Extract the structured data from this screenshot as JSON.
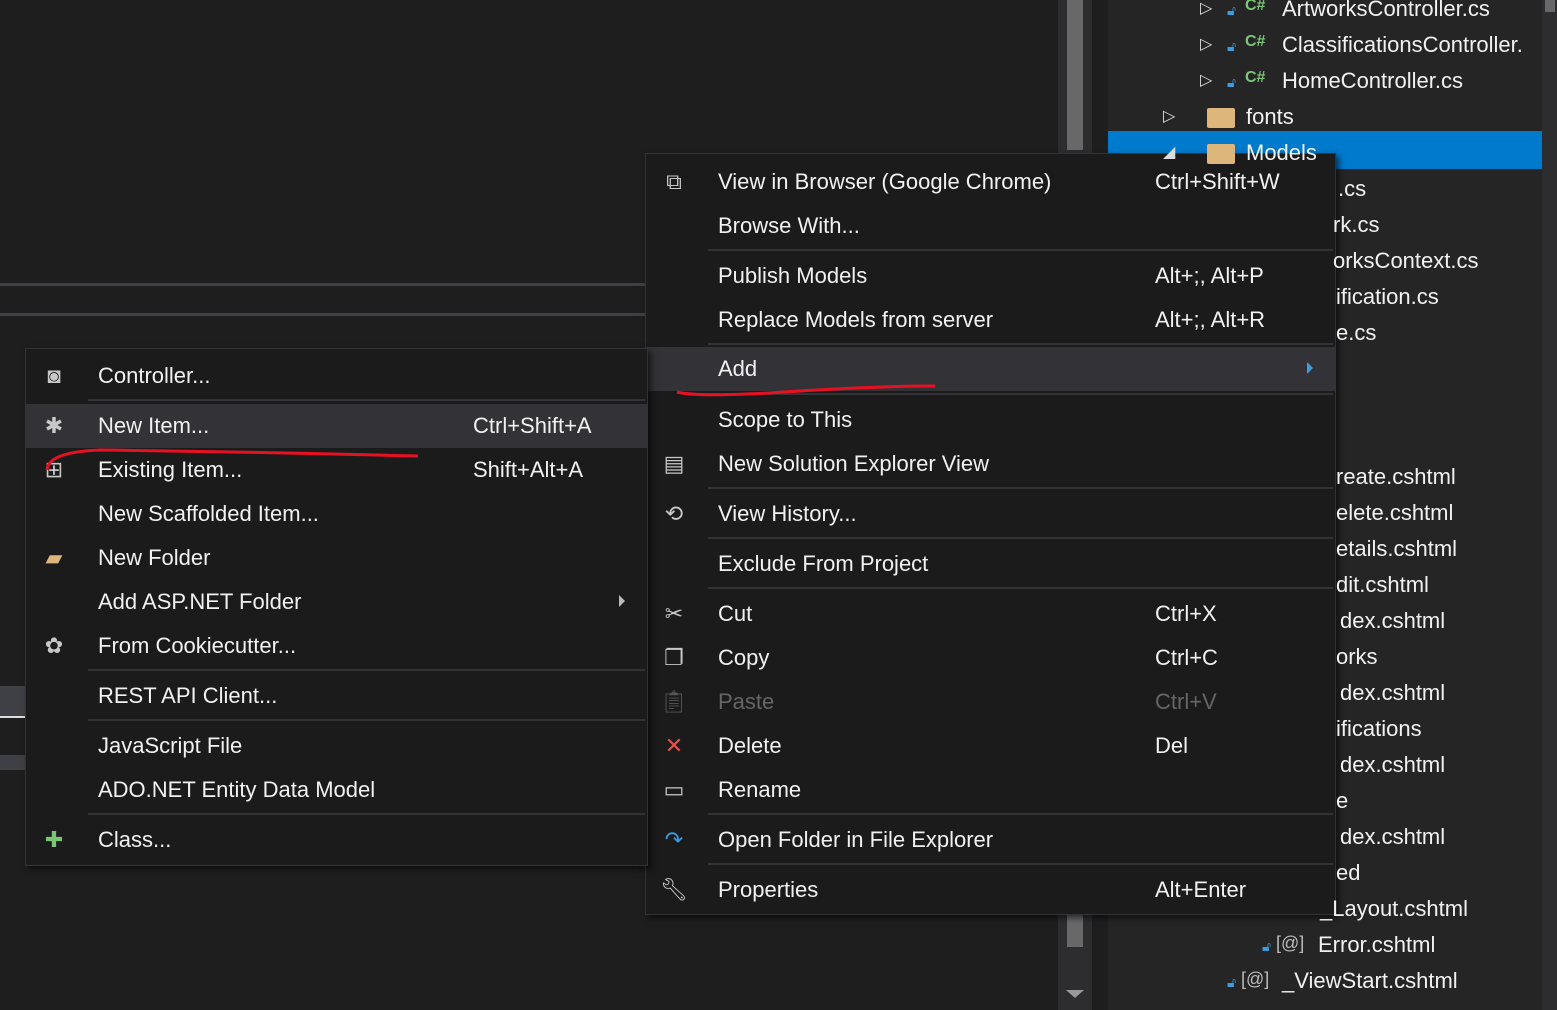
{
  "solution_explorer": {
    "rows_top": [
      {
        "label": "ArtworksController.cs",
        "kind": "csharp"
      },
      {
        "label": "ClassificationsController.",
        "kind": "csharp"
      },
      {
        "label": "HomeController.cs",
        "kind": "csharp"
      },
      {
        "label": "fonts",
        "kind": "folder"
      },
      {
        "label": "Models",
        "kind": "folder-open",
        "selected": true
      }
    ],
    "partial_rows": [
      ".cs",
      "rk.cs",
      "orksContext.cs",
      "ification.cs",
      "e.cs",
      "reate.cshtml",
      "elete.cshtml",
      "etails.cshtml",
      "dit.cshtml",
      "dex.cshtml",
      "orks",
      "dex.cshtml",
      "ifications",
      "dex.cshtml",
      "e",
      "dex.cshtml",
      "ed",
      "_Layout.cshtml"
    ],
    "rows_bottom": [
      {
        "label": "Error.cshtml"
      },
      {
        "label": "_ViewStart.cshtml"
      }
    ],
    "csharp_glyph": "C#",
    "razor_glyph": "[@]"
  },
  "context_menu": {
    "items": [
      {
        "label": "View in Browser (Google Chrome)",
        "shortcut": "Ctrl+Shift+W",
        "icon": "browser-icon"
      },
      {
        "label": "Browse With...",
        "shortcut": ""
      },
      {
        "label": "Publish Models",
        "shortcut": "Alt+;, Alt+P"
      },
      {
        "label": "Replace Models from server",
        "shortcut": "Alt+;, Alt+R"
      },
      {
        "label": "Add",
        "shortcut": "",
        "submenu": true,
        "highlighted": true
      },
      {
        "label": "Scope to This",
        "shortcut": ""
      },
      {
        "label": "New Solution Explorer View",
        "shortcut": "",
        "icon": "solution-explorer-icon"
      },
      {
        "label": "View History...",
        "shortcut": "",
        "icon": "history-icon"
      },
      {
        "label": "Exclude From Project",
        "shortcut": ""
      },
      {
        "label": "Cut",
        "shortcut": "Ctrl+X",
        "icon": "scissors-icon"
      },
      {
        "label": "Copy",
        "shortcut": "Ctrl+C",
        "icon": "copy-icon"
      },
      {
        "label": "Paste",
        "shortcut": "Ctrl+V",
        "icon": "paste-icon",
        "disabled": true
      },
      {
        "label": "Delete",
        "shortcut": "Del",
        "icon": "delete-icon"
      },
      {
        "label": "Rename",
        "shortcut": "",
        "icon": "rename-icon"
      },
      {
        "label": "Open Folder in File Explorer",
        "shortcut": "",
        "icon": "open-folder-icon"
      },
      {
        "label": "Properties",
        "shortcut": "Alt+Enter",
        "icon": "wrench-icon"
      }
    ]
  },
  "add_submenu": {
    "items": [
      {
        "label": "Controller...",
        "shortcut": "",
        "icon": "controller-icon"
      },
      {
        "label": "New Item...",
        "shortcut": "Ctrl+Shift+A",
        "icon": "new-item-icon",
        "highlighted": true
      },
      {
        "label": "Existing Item...",
        "shortcut": "Shift+Alt+A",
        "icon": "existing-item-icon"
      },
      {
        "label": "New Scaffolded Item...",
        "shortcut": ""
      },
      {
        "label": "New Folder",
        "shortcut": "",
        "icon": "new-folder-icon"
      },
      {
        "label": "Add ASP.NET Folder",
        "shortcut": "",
        "submenu": true
      },
      {
        "label": "From Cookiecutter...",
        "shortcut": "",
        "icon": "cookiecutter-icon"
      },
      {
        "label": "REST API Client...",
        "shortcut": ""
      },
      {
        "label": "JavaScript File",
        "shortcut": ""
      },
      {
        "label": "ADO.NET Entity Data Model",
        "shortcut": ""
      },
      {
        "label": "Class...",
        "shortcut": "",
        "icon": "add-class-icon"
      }
    ]
  },
  "colors": {
    "selection": "#007acc",
    "menu_bg": "#1b1b1c",
    "highlight": "#333337",
    "annotation": "#e81123",
    "delete": "#e8514a",
    "accent_icon": "#3b9ce0"
  }
}
